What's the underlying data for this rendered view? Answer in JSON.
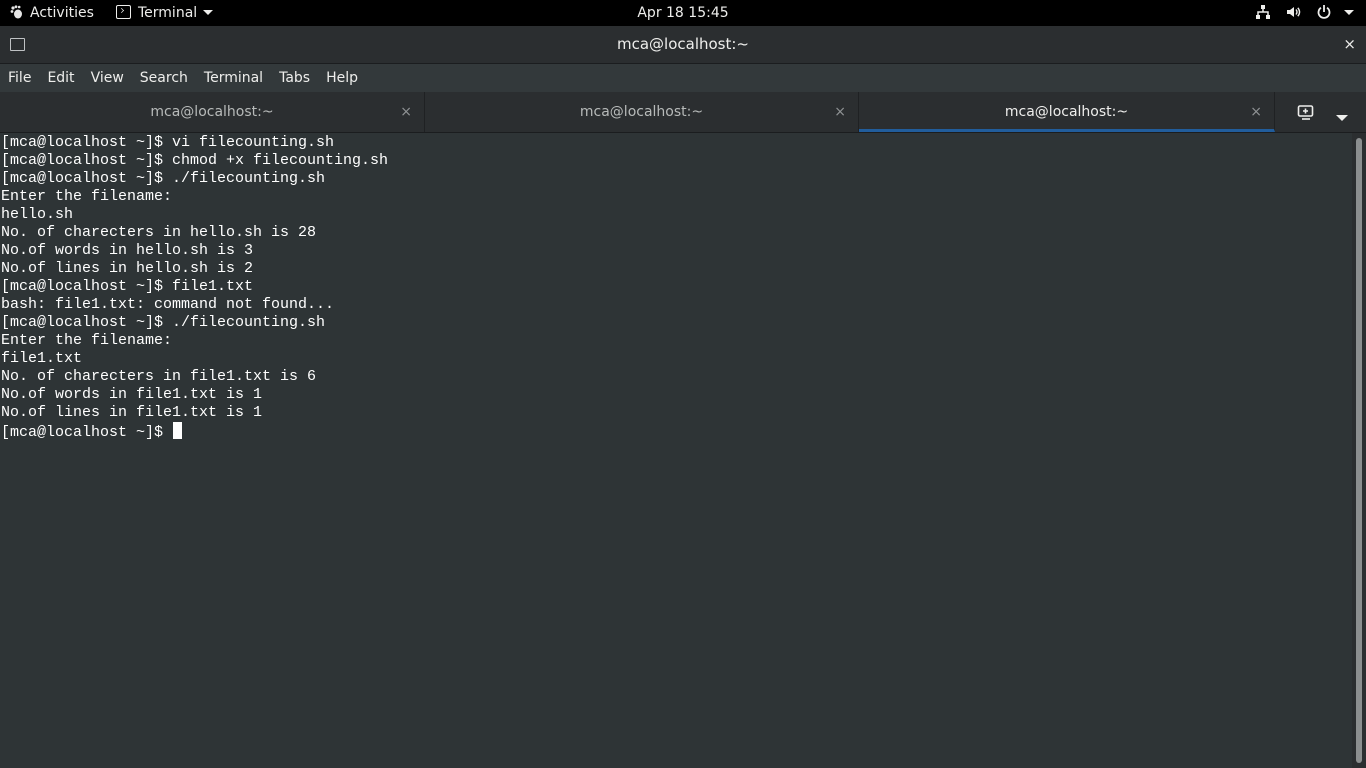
{
  "topbar": {
    "activities": "Activities",
    "app_name": "Terminal",
    "clock": "Apr 18  15:45",
    "icons": [
      "network-icon",
      "volume-icon",
      "power-icon",
      "chevron-down-icon"
    ]
  },
  "window": {
    "title": "mca@localhost:~",
    "close": "×"
  },
  "menubar": {
    "items": [
      "File",
      "Edit",
      "View",
      "Search",
      "Terminal",
      "Tabs",
      "Help"
    ]
  },
  "tabs": [
    {
      "label": "mca@localhost:~",
      "active": false
    },
    {
      "label": "mca@localhost:~",
      "active": false
    },
    {
      "label": "mca@localhost:~",
      "active": true
    }
  ],
  "tab_close": "×",
  "terminal": {
    "lines": [
      "[mca@localhost ~]$ vi filecounting.sh",
      "[mca@localhost ~]$ chmod +x filecounting.sh",
      "[mca@localhost ~]$ ./filecounting.sh",
      "Enter the filename:",
      "hello.sh",
      "No. of charecters in hello.sh is 28",
      "No.of words in hello.sh is 3",
      "No.of lines in hello.sh is 2",
      "[mca@localhost ~]$ file1.txt",
      "bash: file1.txt: command not found...",
      "[mca@localhost ~]$ ./filecounting.sh",
      "Enter the filename:",
      "file1.txt",
      "No. of charecters in file1.txt is 6",
      "No.of words in file1.txt is 1",
      "No.of lines in file1.txt is 1",
      "[mca@localhost ~]$ "
    ]
  },
  "colors": {
    "terminal_bg": "#2e3436",
    "terminal_fg": "#ffffff",
    "active_tab_underline": "#215d9c",
    "topbar_bg": "#000000"
  }
}
